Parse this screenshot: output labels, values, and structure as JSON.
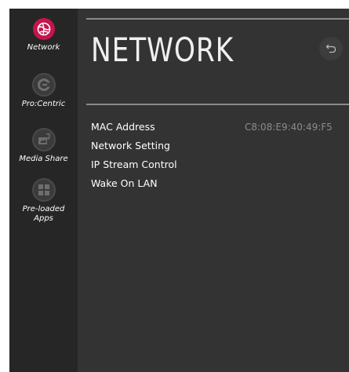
{
  "sidebar": {
    "items": [
      {
        "label": "Network",
        "icon": "globe-icon",
        "active": true
      },
      {
        "label": "Pro:Centric",
        "icon": "procentric-icon",
        "active": false
      },
      {
        "label": "Media Share",
        "icon": "media-share-icon",
        "active": false
      },
      {
        "label": "Pre-loaded\nApps",
        "icon": "apps-grid-icon",
        "active": false
      }
    ]
  },
  "header": {
    "title": "NETWORK",
    "back_icon": "back-arrow-icon"
  },
  "menu": {
    "items": [
      {
        "label": "MAC Address",
        "value": "C8:08:E9:40:49:F5"
      },
      {
        "label": "Network Setting",
        "value": ""
      },
      {
        "label": "IP Stream Control",
        "value": ""
      },
      {
        "label": "Wake On LAN",
        "value": ""
      }
    ]
  },
  "colors": {
    "accent": "#c4164d",
    "background": "#333333",
    "sidebar": "#262626",
    "muted_text": "#8c8c8c"
  }
}
